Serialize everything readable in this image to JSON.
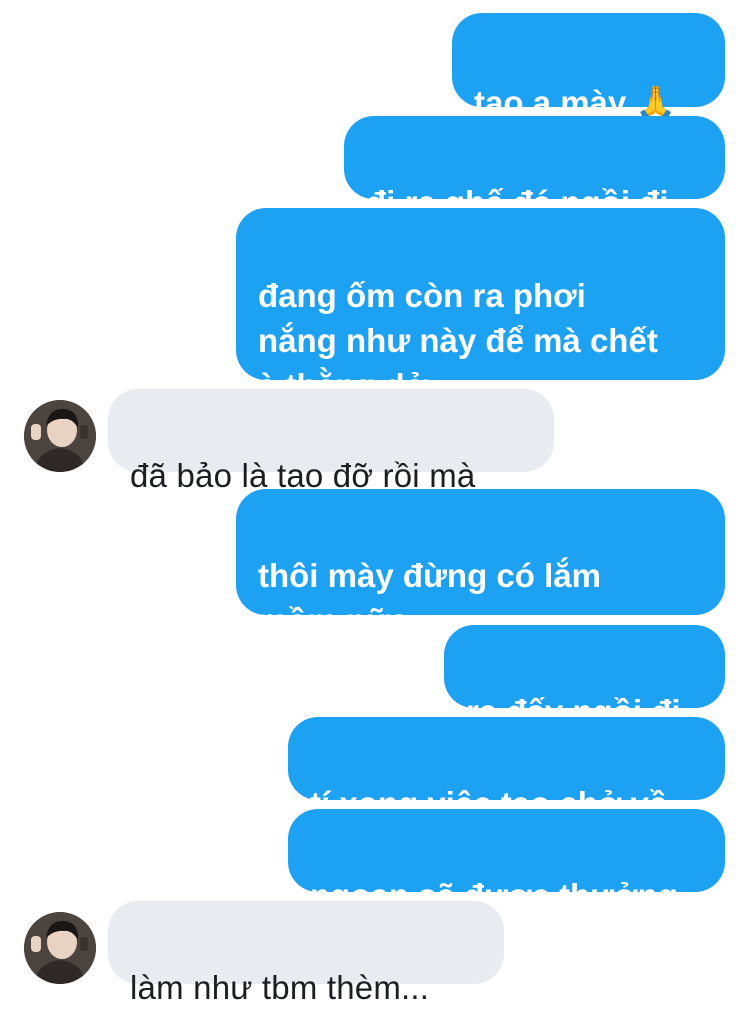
{
  "conversation": {
    "messages": [
      {
        "side": "sent",
        "text": "tao ạ mày 🙏"
      },
      {
        "side": "sent",
        "text": "đi ra ghế đá ngồi đi"
      },
      {
        "side": "sent",
        "text": "đang ốm còn ra phơi\nnắng như này để mà chết\nà thằng dở"
      },
      {
        "side": "received",
        "text": "đã bảo là tao đỡ rồi mà"
      },
      {
        "side": "sent",
        "text": "thôi mày đừng có lắm\nmồm nữa"
      },
      {
        "side": "sent",
        "text": "ra đấy ngồi đi"
      },
      {
        "side": "sent",
        "text": "tí xong việc tao chở về"
      },
      {
        "side": "sent",
        "text": "ngoan sẽ được thưởng"
      },
      {
        "side": "received",
        "text": "làm như tbm thèm..."
      }
    ]
  },
  "colors": {
    "sent_bubble": "#1da1f2",
    "received_bubble": "#e8ebef",
    "sent_text": "#ffffff",
    "received_text": "#1c1e21"
  },
  "icons": {
    "avatar": "user-avatar-photo"
  }
}
